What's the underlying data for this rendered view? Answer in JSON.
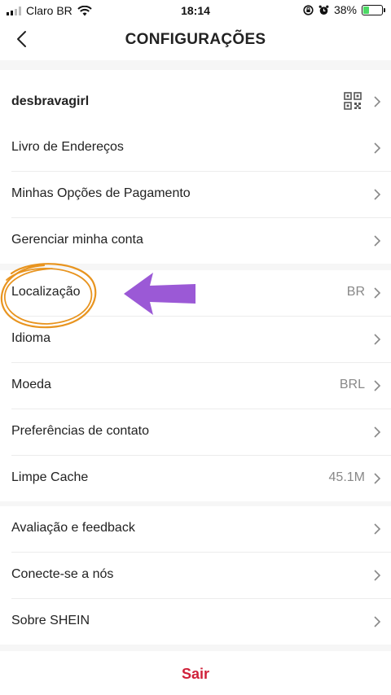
{
  "status_bar": {
    "carrier": "Claro BR",
    "time": "18:14",
    "battery_percent": "38%",
    "battery_level": 0.38
  },
  "header": {
    "title": "CONFIGURAÇÕES"
  },
  "profile": {
    "username": "desbravagirl"
  },
  "groups": [
    {
      "items": [
        {
          "label": "Livro de Endereços",
          "value": ""
        },
        {
          "label": "Minhas Opções de Pagamento",
          "value": ""
        },
        {
          "label": "Gerenciar minha conta",
          "value": ""
        }
      ]
    },
    {
      "items": [
        {
          "label": "Localização",
          "value": "BR"
        },
        {
          "label": "Idioma",
          "value": ""
        },
        {
          "label": "Moeda",
          "value": "BRL"
        },
        {
          "label": "Preferências de contato",
          "value": ""
        },
        {
          "label": "Limpe Cache",
          "value": "45.1M"
        }
      ]
    },
    {
      "items": [
        {
          "label": "Avaliação e feedback",
          "value": ""
        },
        {
          "label": "Conecte-se a nós",
          "value": ""
        },
        {
          "label": "Sobre SHEIN",
          "value": ""
        }
      ]
    }
  ],
  "logout_label": "Sair",
  "colors": {
    "logout": "#d0213a",
    "annotation_circle": "#e8941f",
    "annotation_arrow": "#9b59d6",
    "battery_fill": "#4cd964"
  }
}
